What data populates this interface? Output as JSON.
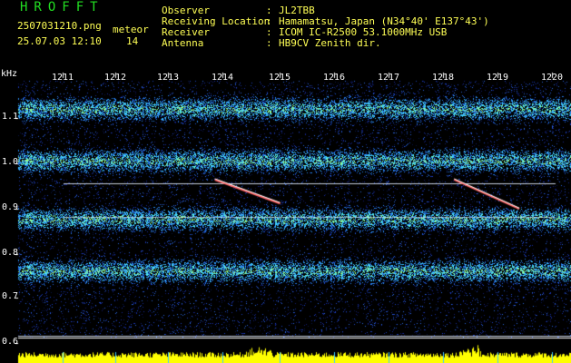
{
  "header": {
    "brand": "HROFFT",
    "filename": "2507031210.png",
    "datetime": "25.07.03 12:10",
    "meteor_label": "meteor",
    "meteor_count": "14",
    "fields": [
      {
        "label": "Observer",
        "sep": ":",
        "value": "JL2TBB"
      },
      {
        "label": "Receiving Location",
        "sep": ":",
        "value": "Hamamatsu, Japan (N34°40' E137°43')"
      },
      {
        "label": "Receiver",
        "sep": ":",
        "value": "ICOM IC-R2500 53.1000MHz USB"
      },
      {
        "label": "Antenna",
        "sep": ":",
        "value": "HB9CV Zenith dir."
      }
    ]
  },
  "axes": {
    "y_unit": "kHz",
    "y_ticks": [
      "1.1",
      "1.0",
      "0.9",
      "0.8",
      "0.7",
      "0.6"
    ],
    "x_ticks": [
      "1211",
      "1212",
      "1213",
      "1214",
      "1215",
      "1216",
      "1217",
      "1218",
      "1219",
      "1220"
    ]
  },
  "colors": {
    "background": "#000000",
    "noise": "#1a2a8a",
    "band": "#3cc8ff",
    "meteor": "#ffffff",
    "carrier": "#e6f0ff",
    "spectrum": "#ffff00",
    "brand": "#22dd22",
    "header_yellow": "#ffff55"
  },
  "signal": {
    "freq_range_khz": [
      0.595,
      1.163
    ],
    "time_range_min": [
      1210.6,
      1220.05
    ],
    "noise_bands_khz": [
      1.12,
      1.005,
      0.875,
      0.76
    ],
    "carriers_khz": [
      0.955,
      0.88,
      0.617
    ],
    "meteors": [
      {
        "t0": 1213.8,
        "f0": 0.965,
        "t1": 1215.0,
        "f1": 0.912
      },
      {
        "t0": 1218.2,
        "f0": 0.965,
        "t1": 1219.4,
        "f1": 0.9
      }
    ]
  }
}
